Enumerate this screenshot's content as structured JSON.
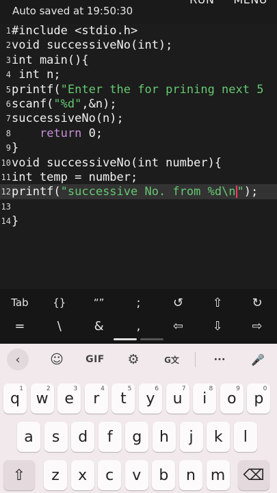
{
  "status": {
    "autosave_text": "Auto saved at 19:50:30"
  },
  "top_actions": {
    "run": "RUN",
    "menu": "MENU"
  },
  "editor": {
    "lines": [
      {
        "num": "1",
        "segments": [
          [
            "#include <stdio.h>",
            "plain"
          ]
        ]
      },
      {
        "num": "2",
        "segments": [
          [
            "void successiveNo(int);",
            "plain"
          ]
        ]
      },
      {
        "num": "3",
        "segments": [
          [
            "int main(){",
            "plain"
          ]
        ]
      },
      {
        "num": "4",
        "segments": [
          [
            " int n;",
            "plain"
          ]
        ]
      },
      {
        "num": "5",
        "segments": [
          [
            "printf(",
            "plain"
          ],
          [
            "\"Enter the for prining next 5",
            "str"
          ]
        ]
      },
      {
        "num": "6",
        "segments": [
          [
            "scanf(",
            "plain"
          ],
          [
            "\"%d\"",
            "str"
          ],
          [
            ",&n);",
            "plain"
          ]
        ]
      },
      {
        "num": "7",
        "segments": [
          [
            "successiveNo(n);",
            "plain"
          ]
        ]
      },
      {
        "num": "8",
        "segments": [
          [
            "    ",
            "plain"
          ],
          [
            "return",
            "kw"
          ],
          [
            " 0;",
            "plain"
          ]
        ]
      },
      {
        "num": "9",
        "segments": [
          [
            "}",
            "plain"
          ]
        ]
      },
      {
        "num": "10",
        "segments": [
          [
            "void successiveNo(int number){",
            "plain"
          ]
        ]
      },
      {
        "num": "11",
        "segments": [
          [
            "int temp = number;",
            "plain"
          ]
        ]
      },
      {
        "num": "12",
        "segments": [
          [
            "printf(",
            "plain"
          ],
          [
            "\"successive No. from %d\\n",
            "str"
          ],
          [
            "|",
            "cursor"
          ],
          [
            "\"",
            "str"
          ],
          [
            ");",
            "plain"
          ]
        ]
      },
      {
        "num": "13",
        "segments": []
      },
      {
        "num": "14",
        "segments": [
          [
            "}",
            "plain"
          ]
        ]
      }
    ],
    "active_line": 11
  },
  "symbol_bar": {
    "row1": [
      "Tab",
      "{}",
      "“”",
      ";",
      "↺",
      "⇧",
      "↻"
    ],
    "row2": [
      "=",
      "\\",
      "&",
      ",",
      "⇦",
      "⇩",
      "⇨"
    ]
  },
  "keyboard": {
    "toolbar": {
      "back": "‹",
      "sticker": "☺",
      "gif": "GIF",
      "settings": "⚙",
      "translate": "G文",
      "more": "···",
      "mic": "🎤"
    },
    "row1": [
      [
        "q",
        "1"
      ],
      [
        "w",
        "2"
      ],
      [
        "e",
        "3"
      ],
      [
        "r",
        "4"
      ],
      [
        "t",
        "5"
      ],
      [
        "y",
        "6"
      ],
      [
        "u",
        "7"
      ],
      [
        "i",
        "8"
      ],
      [
        "o",
        "9"
      ],
      [
        "p",
        "0"
      ]
    ],
    "row2": [
      "a",
      "s",
      "d",
      "f",
      "g",
      "h",
      "j",
      "k",
      "l"
    ],
    "row3": {
      "shift": "⇧",
      "letters": [
        "z",
        "x",
        "c",
        "v",
        "b",
        "n",
        "m"
      ],
      "backspace": "⌫"
    }
  },
  "colors": {
    "editor_bg": "#1c1c1c",
    "string": "#66c872",
    "keyword": "#c78ed8",
    "cursor": "#ff3b5c",
    "keyboard_bg": "#f1e9ec"
  }
}
